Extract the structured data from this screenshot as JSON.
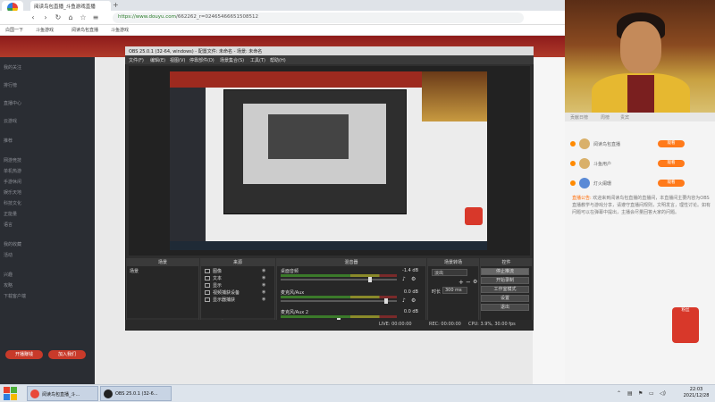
{
  "browser": {
    "tab_title": "阅读鸟包直播_斗鱼游戏直播",
    "url_host": "https://www.douyu.com",
    "url_rest": "/662262_r=02465466651508512",
    "logo_label": "过度编辑",
    "bookmarks": [
      "白国一下",
      "斗鱼游戏",
      "阅读鸟包直播",
      "斗鱼游戏"
    ]
  },
  "sidebar": {
    "items": [
      "我的关注",
      "排行榜",
      "直播中心",
      "云游戏",
      "推荐",
      "网游竞技",
      "单机热游",
      "手游休闲",
      "娱乐天地",
      "科技文化",
      "正能量",
      "语言",
      "我的收藏",
      "活动",
      "兴趣",
      "攻略",
      "下载客户端"
    ],
    "pill_left": "开播赚钱",
    "pill_right": "加入我们"
  },
  "obs": {
    "title": "OBS 25.0.1 (32-64, windows) - 配置文件: 未命名 - 场景: 未命名",
    "menu": [
      "文件(F)",
      "编辑(E)",
      "视图(V)",
      "停靠部件(D)",
      "场景集合(S)",
      "工具(T)",
      "帮助(H)"
    ],
    "docks": {
      "scenes": {
        "title": "场景",
        "items": [
          "场景"
        ]
      },
      "sources": {
        "title": "来源",
        "items": [
          "图像",
          "文本",
          "显示",
          "视频捕获设备",
          "显示器捕获"
        ]
      },
      "mixer": {
        "title": "混音器",
        "channels": [
          {
            "name": "桌面音频",
            "db": "-1.4 dB",
            "level": 0.78
          },
          {
            "name": "麦克风/Aux",
            "db": "0.0 dB",
            "level": 0.92
          },
          {
            "name": "麦克风/Aux 2",
            "db": "0.0 dB",
            "level": 0.5
          }
        ]
      },
      "transitions": {
        "title": "场景转场",
        "type": "淡出",
        "duration_label": "时长",
        "duration": "300 ms"
      },
      "controls": {
        "title": "控件",
        "buttons": [
          "停止推流",
          "开始录制",
          "工作室模式",
          "设置",
          "退出"
        ]
      }
    },
    "status": {
      "live": "LIVE: 00:00:00",
      "rec": "REC: 00:00:00",
      "cpu": "CPU: 3.9%, 30.00 fps"
    }
  },
  "chat": {
    "tabs": [
      "贡献日榜",
      "周榜",
      "贵宾"
    ],
    "ranking": [
      {
        "name": "阅读鸟包直播",
        "btn": "观看"
      },
      {
        "name": "斗鱼用户",
        "btn": "观看"
      },
      {
        "name": "灯火阑珊",
        "btn": "观看"
      }
    ],
    "notice_tag": "直播公告:",
    "notice_text": "欢迎来到阅读鸟包直播的直播间，本直播间主要内容为OBS直播教学与游戏分享，请遵守直播间规则，文明发言，理性讨论。如有问题可以在弹幕中提出，主播会尽量回答大家的问题。",
    "gift_label": "粉丝"
  },
  "taskbar": {
    "apps": [
      {
        "label": "阅读鸟包直播_斗...",
        "color": "#e9483a"
      },
      {
        "label": "OBS 25.0.1 (32-6...",
        "color": "#222222"
      }
    ],
    "time": "22:03",
    "date": "2021/12/28"
  },
  "colors": {
    "douyu_orange": "#ff7a1a",
    "obs_dark": "#2e2e2e",
    "page_red": "#9d2a1f"
  }
}
